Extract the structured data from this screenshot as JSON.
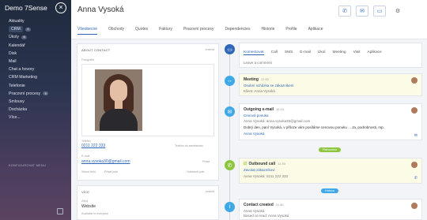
{
  "sidebar": {
    "title": "Demo 7Sense",
    "close_icon": "close-icon",
    "items": [
      {
        "label": "Aktuality",
        "badge": ""
      },
      {
        "label": "CRM",
        "badge": "2"
      },
      {
        "label": "Úkoly",
        "badge": "6"
      },
      {
        "label": "Kalendář",
        "badge": ""
      },
      {
        "label": "Disk",
        "badge": ""
      },
      {
        "label": "Mail",
        "badge": ""
      },
      {
        "label": "Chat a hovory",
        "badge": ""
      },
      {
        "label": "CRM Marketing",
        "badge": ""
      },
      {
        "label": "Telefonie",
        "badge": ""
      },
      {
        "label": "Pracovní procesy",
        "badge": "9"
      },
      {
        "label": "Smlouvy",
        "badge": ""
      },
      {
        "label": "Docházka",
        "badge": ""
      },
      {
        "label": "Více...",
        "badge": ""
      }
    ],
    "customize_label": "KONFIGUROVAT MENU"
  },
  "header": {
    "name": "Anna Vysoká",
    "tabs": [
      "Všeobecné",
      "Obchody",
      "Quotes",
      "Faktury",
      "Pracovní procesy",
      "Dependencies",
      "Historie",
      "Profile",
      "Aplikace"
    ],
    "active_tab": 0
  },
  "about": {
    "title": "ABOUT CONTACT",
    "edit": "změnit",
    "photo_label": "Fotografie",
    "phone_label": "Telefon",
    "phone": "0211 222 333",
    "phone_type": "Telefon do zaměstnání",
    "email_label": "E-mail",
    "email": "anna.vysoka30@gmail.com",
    "email_type": "Práce",
    "select_label": "Select field",
    "select_value": "Přidat pole",
    "delete_label": "Odstranit pole"
  },
  "more": {
    "title": "VÍCE",
    "edit": "změnit",
    "source_label": "Zdroj",
    "source": "Website",
    "available_label": "Available to everyone"
  },
  "composer": {
    "tabs": [
      "Komentovat",
      "Call",
      "SMS",
      "E-mail",
      "Úkol",
      "Meeting",
      "Visit",
      "Aplikace"
    ],
    "placeholder": "Leave a comment"
  },
  "feed": [
    {
      "type": "Meeting",
      "time": "17:00",
      "lines": [
        "Osobní schůzka se zákazníkem",
        "Klient: Anna Vysoká"
      ]
    },
    {
      "type": "Outgoing e-mail",
      "time": "15:15",
      "lines": [
        "Cenová ponuka",
        "Anna Vysoká: anna.vysoka30@gmail.com",
        "Dobrý den, paní Vysoká, v příloze vám posíláme cenovou ponuku ... Ja, podrobnosti, mp.",
        "Anna Vysoká"
      ]
    },
    {
      "type": "Outbound call",
      "time": "11:30",
      "lines": [
        "Zavolat zákazníkovi",
        "Anna Vysoká: 0211 222 333"
      ]
    },
    {
      "type": "Contact created",
      "time": "11:30",
      "lines": [
        "Anna Vysoká",
        "Based on lead: Anna Vysoká"
      ]
    }
  ],
  "pills": {
    "planned": "Plánováno",
    "done": "Hotovo"
  },
  "colors": {
    "accent": "#2f66b8",
    "planned": "#8cc63f",
    "done": "#3fa9e8"
  }
}
